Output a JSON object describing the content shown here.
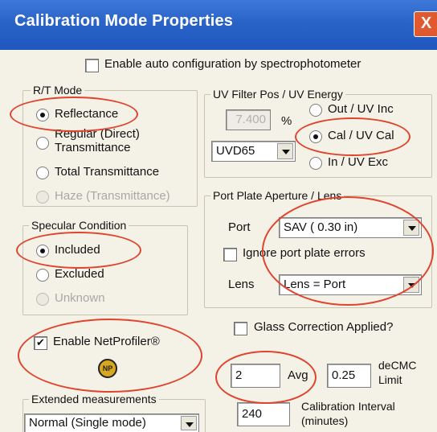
{
  "window": {
    "title": "Calibration Mode Properties",
    "close_symbol": "X"
  },
  "auto_config": {
    "label": "Enable auto configuration by spectrophotometer",
    "checked": false
  },
  "rt_mode": {
    "legend": "R/T Mode",
    "options": [
      {
        "label": "Reflectance",
        "selected": true,
        "enabled": true
      },
      {
        "label_line1": "Regular  (Direct)",
        "label_line2": "Transmittance",
        "selected": false,
        "enabled": true
      },
      {
        "label": "Total Transmittance",
        "selected": false,
        "enabled": true
      },
      {
        "label": "Haze (Transmittance)",
        "selected": false,
        "enabled": false
      }
    ]
  },
  "specular": {
    "legend": "Specular Condition",
    "options": [
      {
        "label": "Included",
        "selected": true,
        "enabled": true
      },
      {
        "label": "Excluded",
        "selected": false,
        "enabled": true
      },
      {
        "label": "Unknown",
        "selected": false,
        "enabled": false
      }
    ]
  },
  "netprofiler": {
    "label": "Enable NetProfiler®",
    "checked": true,
    "logo_text": "NP"
  },
  "extended": {
    "legend": "Extended measurements",
    "value": "Normal (Single mode)"
  },
  "uv_filter": {
    "legend": "UV Filter Pos / UV Energy",
    "percent_value": "7.400",
    "percent_unit": "%",
    "illuminant": "UVD65",
    "options": [
      {
        "label": "Out / UV Inc",
        "selected": false
      },
      {
        "label": "Cal / UV Cal",
        "selected": true
      },
      {
        "label": "In  / UV Exc",
        "selected": false
      }
    ]
  },
  "port_plate": {
    "legend": "Port Plate Aperture / Lens",
    "port_label": "Port",
    "port_value": "SAV ( 0.30 in)",
    "ignore_label": "Ignore port plate errors",
    "ignore_checked": false,
    "lens_label": "Lens",
    "lens_value": "Lens = Port"
  },
  "glass": {
    "label": "Glass Correction Applied?",
    "checked": false
  },
  "avg": {
    "value": "2",
    "label": "Avg"
  },
  "decmc": {
    "value": "0.25",
    "label_line1": "deCMC",
    "label_line2": "Limit"
  },
  "cal_interval": {
    "value": "240",
    "label_line1": "Calibration Interval",
    "label_line2": "(minutes)"
  },
  "colors": {
    "titlebar": "#2a63c8",
    "annotation": "#e0432e",
    "dialog_bg": "#f4f1e6"
  }
}
